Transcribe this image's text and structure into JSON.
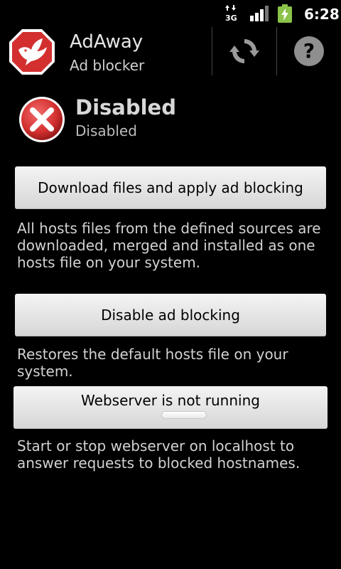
{
  "status_bar": {
    "network_type": "3G",
    "time": "6:28",
    "icons": [
      "network-3g-icon",
      "signal-icon",
      "battery-charging-icon"
    ]
  },
  "action_bar": {
    "app_name": "AdAway",
    "subtitle": "Ad blocker",
    "logo_icon": "adaway-dove-logo-icon",
    "actions": [
      {
        "name": "refresh",
        "icon": "refresh-icon"
      },
      {
        "name": "help",
        "icon": "help-icon"
      }
    ]
  },
  "status": {
    "icon": "disabled-x-icon",
    "title": "Disabled",
    "subtitle": "Disabled"
  },
  "main": {
    "apply_button": "Download files and apply ad blocking",
    "apply_description": "All hosts files from the defined sources are downloaded, merged and installed as one hosts file on your system.",
    "revert_button": "Disable ad blocking",
    "revert_description": "Restores the default hosts file on your system.",
    "webserver_button": "Webserver is not running",
    "webserver_description": "Start or stop webserver on localhost to answer requests to blocked hostnames."
  },
  "colors": {
    "background": "#000000",
    "battery": "#8bc34a",
    "logo_red": "#d32f2f",
    "status_red": "#d32f2f"
  }
}
